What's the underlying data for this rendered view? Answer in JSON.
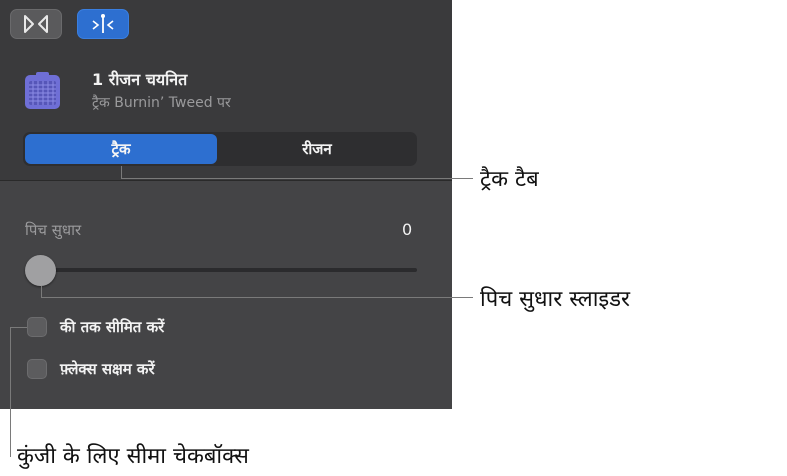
{
  "header": {
    "region_title": "1 रीजन चयनित",
    "region_subtitle": "ट्रैक Burnin’ Tweed पर"
  },
  "tabs": [
    {
      "label": "ट्रैक",
      "selected": true
    },
    {
      "label": "रीजन",
      "selected": false
    }
  ],
  "pitch": {
    "label": "पिच सुधार",
    "value": "0",
    "level": 0
  },
  "checkboxes": [
    {
      "label": "की तक सीमित करें",
      "checked": false
    },
    {
      "label": "फ़्लेक्स सक्षम करें",
      "checked": false
    }
  ],
  "callouts": {
    "track_tab": "ट्रैक टैब",
    "pitch_slider": "पिच सुधार स्लाइडर",
    "key_limit_checkbox": "कुंजी के लिए सीमा चेकबॉक्स"
  },
  "icons": {
    "left_button": "scissors-icon",
    "right_button": "tuning-fork-icon",
    "region": "amp-icon"
  },
  "colors": {
    "accent": "#2d6fd0",
    "panel": "#3a3a3c",
    "amp": "#6f6fd6"
  }
}
